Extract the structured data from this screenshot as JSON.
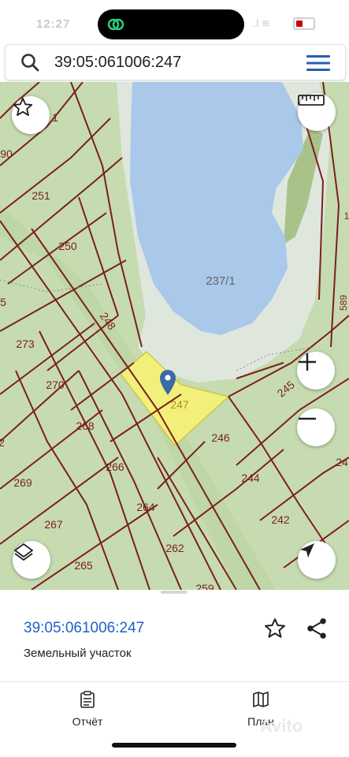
{
  "status": {
    "time": "12:27",
    "right": "..l ≋"
  },
  "search": {
    "query": "39:05:061006:247"
  },
  "map": {
    "lake_label": "237/1",
    "selected_parcel": "247",
    "parcel_labels": [
      "1",
      "90",
      "251",
      "250",
      "5",
      "273",
      "248",
      "270",
      "268",
      "2",
      "269",
      "266",
      "267",
      "264",
      "265",
      "262",
      "259",
      "246",
      "244",
      "242",
      "245",
      "24",
      "589",
      "1"
    ]
  },
  "sheet": {
    "cadastral_number": "39:05:061006:247",
    "parcel_type": "Земельный участок"
  },
  "tabs": [
    {
      "label": "Отчёт",
      "icon": "report-icon"
    },
    {
      "label": "План",
      "icon": "map-plan-icon"
    }
  ],
  "watermark": "Avito",
  "colors": {
    "accent": "#1e60c8",
    "parcel_fill": "#f2f07a",
    "boundary": "#7a1f1f",
    "water": "#a9c8ea"
  }
}
